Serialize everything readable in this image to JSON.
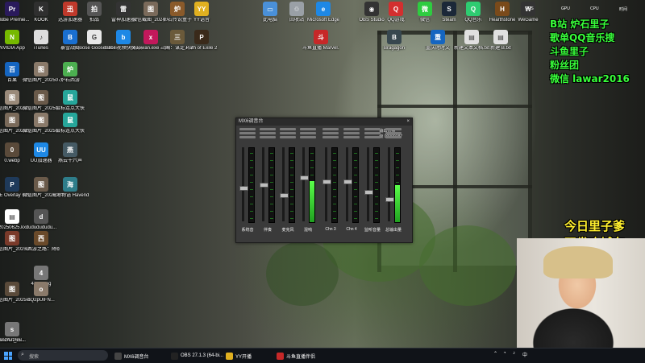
{
  "desktop_icons": [
    {
      "label": "Adobe Premie...",
      "color": "#2a1a5c",
      "glyph": "Pr"
    },
    {
      "label": "KOOK",
      "color": "#2f2f2f",
      "glyph": "K"
    },
    {
      "label": "迅游加速器",
      "color": "#c0392b",
      "glyph": "迅"
    },
    {
      "label": "拍品",
      "color": "#555555",
      "glyph": "拍"
    },
    {
      "label": "雷神加速器",
      "color": "#333333",
      "glyph": "雷"
    },
    {
      "label": "微信截图_2024071...",
      "color": "#7a6a5a",
      "glyph": "图"
    },
    {
      "label": "炉石传说盒子",
      "color": "#8a5a2a",
      "glyph": "炉"
    },
    {
      "label": "YY语音",
      "color": "#e0b020",
      "glyph": "YY"
    },
    {
      "label": "NVIDIA App",
      "color": "#76b900",
      "glyph": "N"
    },
    {
      "label": "iTunes",
      "color": "#dddddd",
      "glyph": "♪"
    },
    {
      "label": "暴雪战网",
      "color": "#1a6fd0",
      "glyph": "B"
    },
    {
      "label": "Goose Goose Duck",
      "color": "#e8e8e8",
      "glyph": "G"
    },
    {
      "label": "bilibili视频快捷方式",
      "color": "#1e88e5",
      "glyph": "b"
    },
    {
      "label": "xiaowan.exe - 快捷方式",
      "color": "#c2185b",
      "glyph": "x"
    },
    {
      "label": "三国：谋定天下",
      "color": "#6b5a3a",
      "glyph": "三"
    },
    {
      "label": "Path of Exile 2",
      "color": "#3a2a1a",
      "glyph": "P"
    },
    {
      "label": "百果",
      "color": "#1565c0",
      "glyph": "百"
    },
    {
      "label": "微信图片_2025072...",
      "color": "#8a7a6a",
      "glyph": "图"
    },
    {
      "label": "炉石西游",
      "color": "#4caf50",
      "glyph": "炉"
    },
    {
      "label": "微信图片_2025020...",
      "color": "#9a8a7a",
      "glyph": "图"
    },
    {
      "label": "微信图片_2025072...",
      "color": "#6a5a4a",
      "glyph": "图"
    },
    {
      "label": "鼠标连点大侠",
      "color": "#26a69a",
      "glyph": "鼠"
    },
    {
      "label": "微信图片_2025020...",
      "color": "#7a6a5a",
      "glyph": "图"
    },
    {
      "label": "微信图片_2025072...",
      "color": "#8a7a6a",
      "glyph": "图"
    },
    {
      "label": "鼠标连点大侠",
      "color": "#26a69a",
      "glyph": "鼠"
    },
    {
      "label": "0.webp",
      "color": "#5a4a3a",
      "glyph": "0"
    },
    {
      "label": "UU加速器",
      "color": "#1e88e5",
      "glyph": "UU"
    },
    {
      "label": "燕云十六声",
      "color": "#455a64",
      "glyph": "燕"
    },
    {
      "label": "PoE Overlay II Standal...",
      "color": "#1f3a5a",
      "glyph": "P"
    },
    {
      "label": "微信图片_2025071...",
      "color": "#6a5a4a",
      "glyph": "图"
    },
    {
      "label": "海港物语 Havendock",
      "color": "#2e7d8a",
      "glyph": "海"
    },
    {
      "label": "20250625.kx",
      "color": "#ffffff",
      "glyph": "▤"
    },
    {
      "label": "dududududu...",
      "color": "#555555",
      "glyph": "d"
    },
    {
      "label": "微信图片_2025062...",
      "color": "#7a3a2a",
      "glyph": "图"
    },
    {
      "label": "《西游之路：降临》委托...",
      "color": "#6a4a2a",
      "glyph": "西"
    },
    {
      "label": "4141.png",
      "color": "#777777",
      "glyph": "4"
    },
    {
      "label": "微信图片_2025091...",
      "color": "#5a4a3a",
      "glyph": "图"
    },
    {
      "label": "oQ2pUIFN...",
      "color": "#8a7a6a",
      "glyph": "o"
    },
    {
      "label": "wechat_20...",
      "color": "#666666",
      "glyph": "w"
    },
    {
      "label": "sn247265...",
      "color": "#777777",
      "glyph": "s"
    }
  ],
  "top_icons": [
    {
      "label": "此电脑",
      "color": "#4a90d9",
      "glyph": "▭"
    },
    {
      "label": "回收站",
      "color": "#9aa0a6",
      "glyph": "♲"
    },
    {
      "label": "Microsoft Edge",
      "color": "#1e88e5",
      "glyph": "e"
    },
    {
      "label": "OBS Studio",
      "color": "#333333",
      "glyph": "◉"
    },
    {
      "label": "QQ游戏",
      "color": "#d32f2f",
      "glyph": "Q"
    },
    {
      "label": "微信",
      "color": "#2ecc40",
      "glyph": "微"
    },
    {
      "label": "Steam",
      "color": "#1b2838",
      "glyph": "S"
    },
    {
      "label": "QQ音乐",
      "color": "#2ecc71",
      "glyph": "Q"
    },
    {
      "label": "Hearthstone",
      "color": "#7a4a1a",
      "glyph": "H"
    },
    {
      "label": "WeGame",
      "color": "#333333",
      "glyph": "W"
    }
  ],
  "second_row_icons": [
    {
      "label": "斗鱼直播 Marvel...",
      "color": "#c62828",
      "glyph": "斗"
    },
    {
      "label": "Bragagon",
      "color": "#37474f",
      "glyph": "B"
    },
    {
      "label": "重庆时时文",
      "color": "#1565c0",
      "glyph": "重"
    },
    {
      "label": "新建文本文档.txt",
      "color": "#e0e0e0",
      "glyph": "▤"
    },
    {
      "label": "新建 B.txt",
      "color": "#e0e0e0",
      "glyph": "▤"
    }
  ],
  "overlay": {
    "line1": "B站 炉石里子",
    "line2": "歌单QQ音乐搜",
    "line3": "斗鱼里子",
    "line4": "粉丝团",
    "line5": "微信  lawar2016",
    "promo1": "今日里子爹",
    "promo2": "双发攻城车"
  },
  "statbar": {
    "fps": "FPS",
    "gpu": "GPU",
    "cpu": "CPU",
    "time": "时间"
  },
  "mixer": {
    "title": "MX6调音台",
    "master_label": "输出音频",
    "master_value": "级 00000187",
    "channels": [
      {
        "name": "系统音",
        "level": 0.0,
        "fader": 0.45
      },
      {
        "name": "伴奏",
        "level": 0.0,
        "fader": 0.5
      },
      {
        "name": "麦克风",
        "level": 0.0,
        "fader": 0.35
      },
      {
        "name": "混响",
        "level": 0.55,
        "fader": 0.6
      },
      {
        "name": "Chn 3",
        "level": 0.0,
        "fader": 0.55
      },
      {
        "name": "Chn 4",
        "level": 0.0,
        "fader": 0.55
      },
      {
        "name": "监听音量",
        "level": 0.0,
        "fader": 0.4
      },
      {
        "name": "总输出量",
        "level": 0.5,
        "fader": 0.3
      }
    ]
  },
  "taskbar": {
    "search_placeholder": "搜索",
    "items": [
      {
        "label": "MX6调音台",
        "color": "#444444"
      },
      {
        "label": "OBS 27.1.3 (64-bi...",
        "color": "#222222"
      },
      {
        "label": "YY开播",
        "color": "#e0b020"
      },
      {
        "label": "斗鱼直播伴侣",
        "color": "#c62828"
      }
    ],
    "tray_lang": "中"
  }
}
